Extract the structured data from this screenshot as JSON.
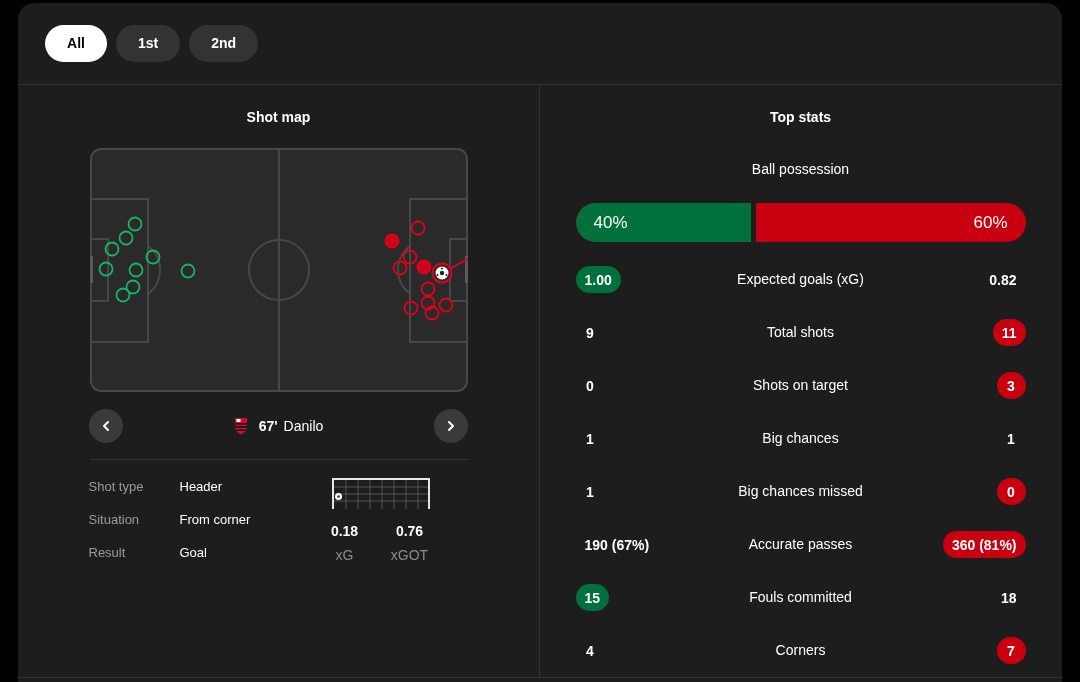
{
  "period_tabs": [
    {
      "label": "All",
      "selected": true
    },
    {
      "label": "1st",
      "selected": false
    },
    {
      "label": "2nd",
      "selected": false
    }
  ],
  "shot_map": {
    "title": "Shot map",
    "selected_shot": {
      "minute": "67'",
      "player": "Danilo"
    },
    "details": [
      {
        "label": "Shot type",
        "value": "Header"
      },
      {
        "label": "Situation",
        "value": "From corner"
      },
      {
        "label": "Result",
        "value": "Goal"
      }
    ],
    "metrics": [
      {
        "value": "0.18",
        "label": "xG"
      },
      {
        "value": "0.76",
        "label": "xGOT"
      }
    ]
  },
  "top_stats": {
    "title": "Top stats",
    "possession": {
      "label": "Ball possession",
      "home": "40%",
      "away": "60%",
      "level": 0.4
    },
    "rows": [
      {
        "label": "Expected goals (xG)",
        "home": "1.00",
        "away": "0.82",
        "home_highlighted": true,
        "away_highlighted": false
      },
      {
        "label": "Total shots",
        "home": "9",
        "away": "11",
        "home_highlighted": false,
        "away_highlighted": true
      },
      {
        "label": "Shots on target",
        "home": "0",
        "away": "3",
        "home_highlighted": false,
        "away_highlighted": true
      },
      {
        "label": "Big chances",
        "home": "1",
        "away": "1",
        "home_highlighted": false,
        "away_highlighted": false
      },
      {
        "label": "Big chances missed",
        "home": "1",
        "away": "0",
        "home_highlighted": false,
        "away_highlighted": true
      },
      {
        "label": "Accurate passes",
        "home": "190 (67%)",
        "away": "360 (81%)",
        "home_highlighted": false,
        "away_highlighted": true
      },
      {
        "label": "Fouls committed",
        "home": "15",
        "away": "18",
        "home_highlighted": true,
        "away_highlighted": false
      },
      {
        "label": "Corners",
        "home": "4",
        "away": "7",
        "home_highlighted": false,
        "away_highlighted": true
      }
    ]
  }
}
